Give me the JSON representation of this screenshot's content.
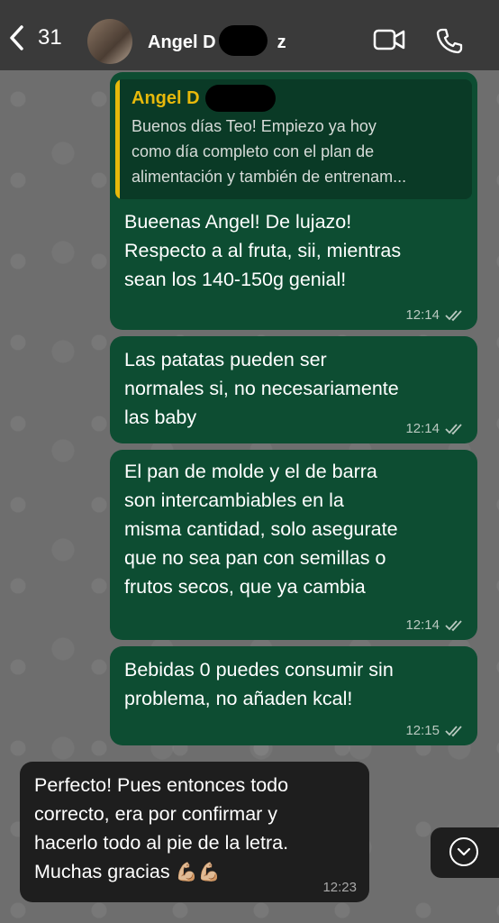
{
  "header": {
    "back_count": "31",
    "contact_name": "Angel D",
    "contact_suffix": "z"
  },
  "messages": [
    {
      "quote_name": "Angel D",
      "quote_text": "Buenos días Teo! Empiezo ya hoy\ncomo día completo con el plan de\nalimentación y también de entrenam...",
      "text": "Bueenas Angel! De lujazo!\nRespecto a al fruta, sii, mientras\nsean los 140-150g genial!",
      "time": "12:14"
    },
    {
      "text": "Las patatas pueden ser\nnormales si, no necesariamente\nlas baby",
      "time": "12:14"
    },
    {
      "text": "El pan de molde y el de barra\nson intercambiables en la\nmisma cantidad, solo asegurate\nque no sea pan con semillas o\nfrutos secos, que ya cambia",
      "time": "12:14"
    },
    {
      "text": "Bebidas 0 puedes consumir sin\nproblema, no añaden kcal!",
      "time": "12:15"
    },
    {
      "text": "Perfecto! Pues entonces todo\ncorrecto, era por confirmar y\nhacerlo todo al pie de la letra.\nMuchas gracias",
      "emoji": "💪🏼💪🏼",
      "time": "12:23"
    }
  ],
  "icons": {
    "back": "chevron-left-icon",
    "video": "video-camera-icon",
    "phone": "phone-icon",
    "read": "double-check-icon",
    "scroll": "chevron-down-circle-icon"
  }
}
